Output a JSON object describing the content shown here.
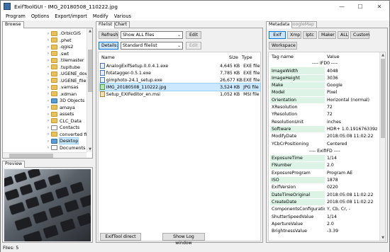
{
  "window": {
    "title": "ExifToolGUI - IMG_20180508_110222.jpg",
    "minimize_glyph": "—",
    "maximize_glyph": "☐",
    "close_glyph": "✕"
  },
  "menu": [
    "Program",
    "Options",
    "Export/import",
    "Modify",
    "Various"
  ],
  "browse": {
    "tab": "Browse",
    "items": [
      {
        "label": ".OrbicGIS",
        "icon": "folder-icon"
      },
      {
        "label": ".phet",
        "icon": "folder-icon"
      },
      {
        "label": ".qgis2",
        "icon": "folder-icon"
      },
      {
        "label": ".swt",
        "icon": "folder-icon"
      },
      {
        "label": ".tilemaster",
        "icon": "folder-icon"
      },
      {
        "label": ".tupitube",
        "icon": "folder-icon"
      },
      {
        "label": ".UGENE_down",
        "icon": "folder-icon"
      },
      {
        "label": ".UGENE_files",
        "icon": "folder-icon"
      },
      {
        "label": ".vamsas",
        "icon": "folder-icon"
      },
      {
        "label": ".xdman",
        "icon": "folder-icon"
      },
      {
        "label": "3D Objects",
        "icon": "3d-objects-icon"
      },
      {
        "label": "amaya",
        "icon": "folder-icon"
      },
      {
        "label": "assets",
        "icon": "folder-icon"
      },
      {
        "label": "CLC_Data",
        "icon": "folder-icon"
      },
      {
        "label": "Contacts",
        "icon": "contacts-icon"
      },
      {
        "label": "converted file",
        "icon": "folder-icon"
      },
      {
        "label": "Desktop",
        "icon": "desktop-icon"
      },
      {
        "label": "Documents",
        "icon": "documents-icon"
      }
    ]
  },
  "preview": {
    "tab": "Preview"
  },
  "filelist": {
    "tab_filelist": "Filelist",
    "tab_chart": "Chart",
    "refresh_label": "Refresh",
    "filter_value": "Show ALL files",
    "edit_label": "Edit",
    "details_label": "Details:",
    "view_value": "Standard filelist",
    "edit2_label": "Edit",
    "col_name": "Name",
    "col_size": "Size",
    "col_type": "Type",
    "rows": [
      {
        "name": "AnalogExifSetup.0.0.4.1.exe",
        "size": "4,645 KB",
        "type": "EXE file",
        "icon": "exe"
      },
      {
        "name": "fotatagger-0.5.1.exe",
        "size": "7,785 KB",
        "type": "EXE file",
        "icon": "exe"
      },
      {
        "name": "gimphoto-24.1_setup.exe",
        "size": "26,677 KB",
        "type": "EXE file",
        "icon": "exe"
      },
      {
        "name": "IMG_20180508_110222.jpg",
        "size": "3,524 KB",
        "type": "JPG file",
        "icon": "jpg"
      },
      {
        "name": "Setup_EXIFeditor_en.msi",
        "size": "1,052 KB",
        "type": "MSI file",
        "icon": "msi"
      }
    ],
    "exiftool_direct_label": "ExifTool direct",
    "show_log_label": "Show Log window"
  },
  "metadata": {
    "tab_metadata": "Metadata",
    "tab_googlemap": "GoogleMap",
    "buttons": [
      "Exif",
      "Xmp",
      "Iptc",
      "Maker",
      "ALL",
      "Custom"
    ],
    "workspace_label": "Workspace",
    "col_tag": "Tag name",
    "col_value": "Value",
    "rows": [
      {
        "tag": "",
        "value": "---- IFD0 ----",
        "section": true
      },
      {
        "tag": "ImageWidth",
        "value": "4048",
        "hl": true
      },
      {
        "tag": "ImageHeight",
        "value": "3036",
        "hl": true
      },
      {
        "tag": "Make",
        "value": "Google",
        "hl": true
      },
      {
        "tag": "Model",
        "value": "Pixel",
        "hl": true
      },
      {
        "tag": "Orientation",
        "value": "Horizontal (normal)",
        "hl": true
      },
      {
        "tag": "XResolution",
        "value": "72",
        "hl": false
      },
      {
        "tag": "YResolution",
        "value": "72",
        "hl": false
      },
      {
        "tag": "ResolutionUnit",
        "value": "inches",
        "hl": false
      },
      {
        "tag": "Software",
        "value": "HDR+ 1.0.191676339z",
        "hl": true
      },
      {
        "tag": "ModifyDate",
        "value": "2018:05:08 11:02:22",
        "hl": false
      },
      {
        "tag": "YCbCrPositioning",
        "value": "Centered",
        "hl": false
      },
      {
        "tag": "",
        "value": "---- ExifIFD ----",
        "section": true
      },
      {
        "tag": "ExposureTime",
        "value": "1/14",
        "hl": true
      },
      {
        "tag": "FNumber",
        "value": "2.0",
        "hl": true
      },
      {
        "tag": "ExposureProgram",
        "value": "Program AE",
        "hl": false
      },
      {
        "tag": "ISO",
        "value": "1878",
        "hl": true
      },
      {
        "tag": "ExifVersion",
        "value": "0220",
        "hl": false
      },
      {
        "tag": "DateTimeOriginal",
        "value": "2018:05:08 11:02:22",
        "hl": true
      },
      {
        "tag": "CreateDate",
        "value": "2018:05:08 11:02:22",
        "hl": true
      },
      {
        "tag": "ComponentsConfiguration",
        "value": "Y, Cb, Cr, -",
        "hl": false
      },
      {
        "tag": "ShutterSpeedValue",
        "value": "1/14",
        "hl": false
      },
      {
        "tag": "ApertureValue",
        "value": "2.0",
        "hl": false
      },
      {
        "tag": "BrightnessValue",
        "value": "-3.39",
        "hl": false
      }
    ]
  },
  "status": {
    "text": "Files: 5"
  },
  "colors": {
    "selection": "#cce8ff",
    "metadata_highlight": "#dcf3e6",
    "button_pressed": "#cce4f7"
  }
}
